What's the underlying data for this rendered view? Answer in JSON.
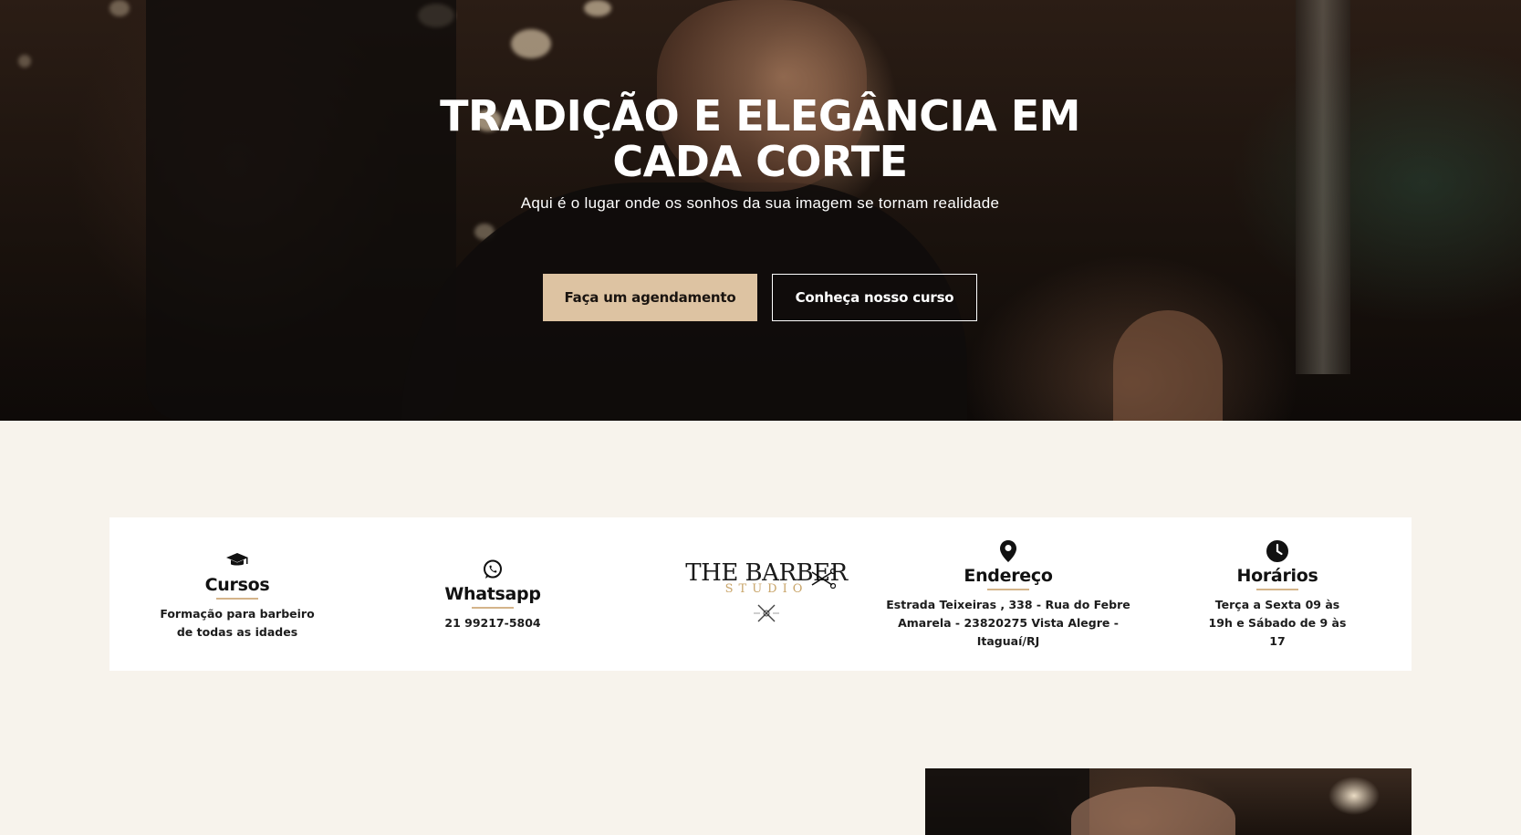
{
  "hero": {
    "title": "TRADIÇÃO E ELEGÂNCIA EM CADA CORTE",
    "subtitle": "Aqui é o lugar onde os sonhos da sua imagem se tornam realidade",
    "primary_button": "Faça um agendamento",
    "secondary_button": "Conheça nosso curso"
  },
  "info": {
    "cursos": {
      "icon": "graduation-cap-icon",
      "title": "Cursos",
      "text": "Formação para barbeiro de todas as idades"
    },
    "whatsapp": {
      "icon": "whatsapp-icon",
      "title": "Whatsapp",
      "text": "21 99217-5804"
    },
    "logo": {
      "main": "THE BARBER",
      "sub": "STUDIO"
    },
    "endereco": {
      "icon": "map-pin-icon",
      "title": "Endereço",
      "text": "Estrada Teixeiras , 338 - Rua do Febre Amarela - 23820275 Vista Alegre - Itaguaí/RJ"
    },
    "horarios": {
      "icon": "clock-icon",
      "title": "Horários",
      "text": "Terça a Sexta 09 às 19h e Sábado de 9 às 17"
    }
  },
  "colors": {
    "accent": "#ddc3a2",
    "underline": "#d4b48a",
    "page_bg": "#f7f3ec"
  }
}
